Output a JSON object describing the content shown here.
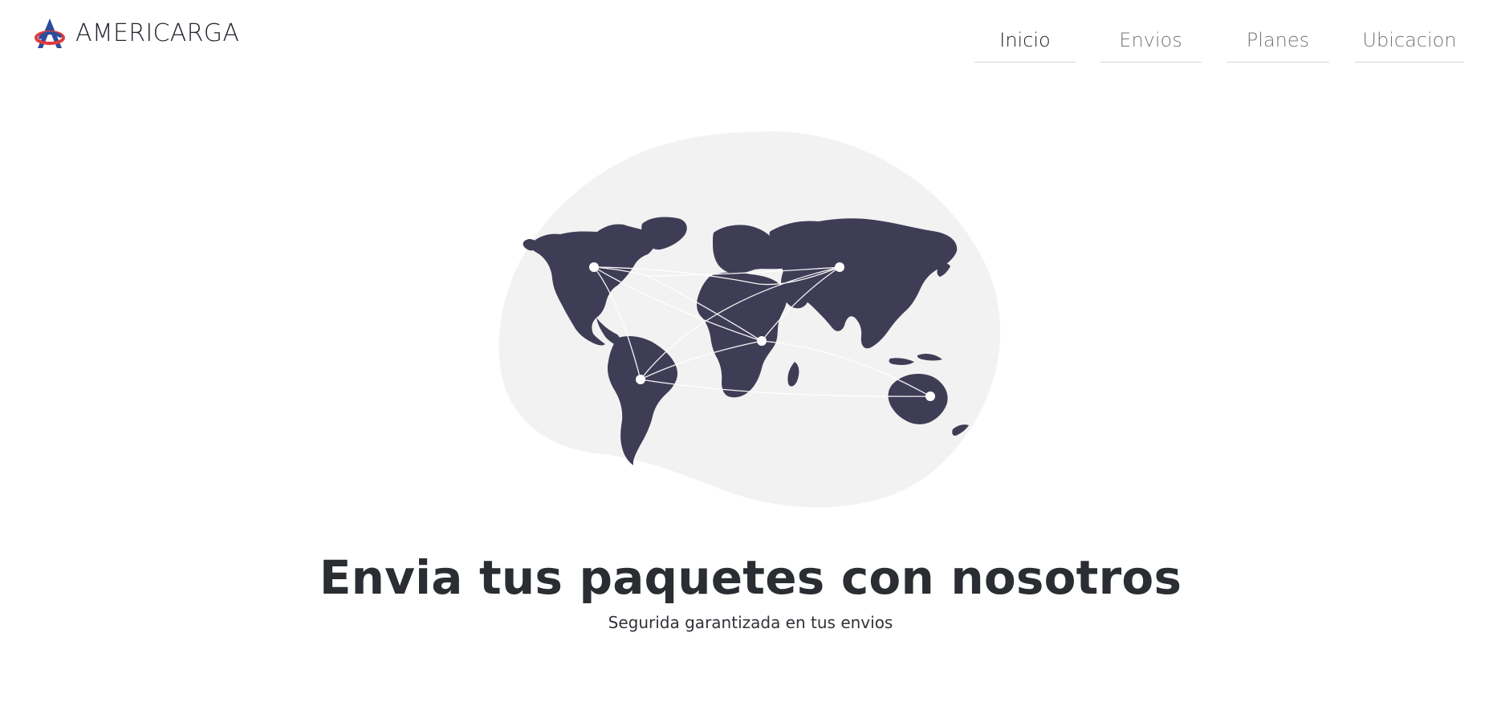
{
  "header": {
    "brand_name": "AMERICARGA",
    "logo_icon": "americarga-logo-icon",
    "nav": [
      {
        "label": "Inicio",
        "active": true
      },
      {
        "label": "Envios",
        "active": false
      },
      {
        "label": "Planes",
        "active": false
      },
      {
        "label": "Ubicacion",
        "active": false
      }
    ]
  },
  "hero": {
    "illustration_icon": "world-shipping-network-icon",
    "title": "Envia tus paquetes con nosotros",
    "subtitle": "Segurida garantizada en tus envios"
  },
  "colors": {
    "map_color": "#3f3d56",
    "blob_color": "#f2f2f2",
    "logo_blue": "#2d4c9c",
    "logo_red": "#e03b3b"
  }
}
